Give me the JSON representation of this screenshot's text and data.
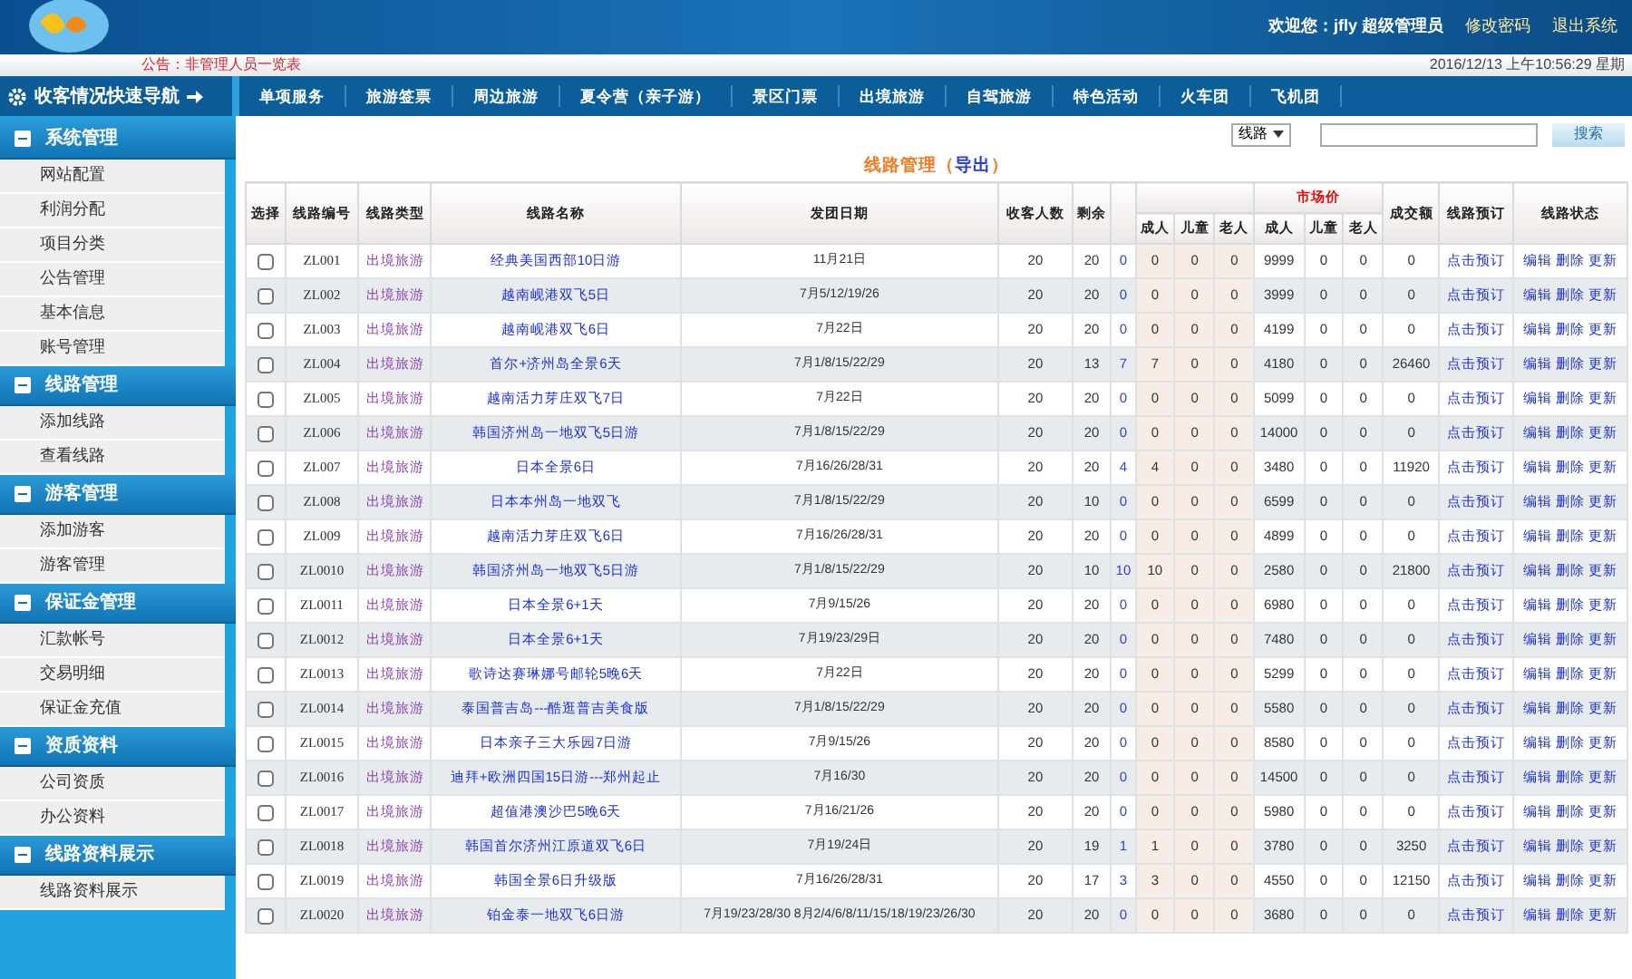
{
  "header": {
    "welcome": "欢迎您：jfly 超级管理员",
    "links": [
      "修改密码",
      "退出系统"
    ],
    "notice": "公告：非管理人员一览表",
    "datetime": "2016/12/13 上午10:56:29 星期"
  },
  "sidebar": {
    "title": "收客情况快速导航",
    "groups": [
      {
        "title": "系统管理",
        "expanded": true,
        "items": [
          "网站配置",
          "利润分配",
          "项目分类",
          "公告管理",
          "基本信息",
          "账号管理"
        ]
      },
      {
        "title": "线路管理",
        "expanded": true,
        "items": [
          "添加线路",
          "查看线路"
        ]
      },
      {
        "title": "游客管理",
        "expanded": true,
        "items": [
          "添加游客",
          "游客管理"
        ]
      },
      {
        "title": "保证金管理",
        "expanded": true,
        "items": [
          "汇款帐号",
          "交易明细",
          "保证金充值"
        ]
      },
      {
        "title": "资质资料",
        "expanded": true,
        "items": [
          "公司资质",
          "办公资料"
        ]
      },
      {
        "title": "线路资料展示",
        "expanded": true,
        "items": [
          "线路资料展示"
        ]
      }
    ]
  },
  "nav": [
    "单项服务",
    "旅游签票",
    "周边旅游",
    "夏令营（亲子游）",
    "景区门票",
    "出境旅游",
    "自驾旅游",
    "特色活动",
    "火车团",
    "飞机团"
  ],
  "search": {
    "filter": "线路",
    "button": "搜索"
  },
  "page_title": {
    "text": "线路管理（",
    "link": "导出",
    "close": "）"
  },
  "table": {
    "columns": [
      "选择",
      "线路编号",
      "线路类型",
      "线路名称",
      "发团日期",
      "收客人数",
      "剩余"
    ],
    "booked_sub": [
      "成人",
      "儿童",
      "老人"
    ],
    "price_group": {
      "label": "市场价",
      "sub": [
        "成人",
        "儿童",
        "老人"
      ]
    },
    "trailing": [
      "成交额",
      "线路预订",
      "线路状态"
    ],
    "rows": [
      {
        "checked": false,
        "id": "ZL001",
        "type": "出境旅游",
        "name": "经典美国西部10日游",
        "date": "11月21日",
        "capacity": "20",
        "remaining": "20",
        "booked": "0",
        "adult": "0",
        "child": "0",
        "senior": "0",
        "price": "9999",
        "price_child": "0",
        "price_senior": "0",
        "total": "0",
        "book": "点击预订",
        "actions": [
          "编辑",
          "删除",
          "更新"
        ]
      },
      {
        "checked": false,
        "id": "ZL002",
        "type": "出境旅游",
        "name": "越南岘港双飞5日",
        "date": "7月5/12/19/26",
        "capacity": "20",
        "remaining": "20",
        "booked": "0",
        "adult": "0",
        "child": "0",
        "senior": "0",
        "price": "3999",
        "price_child": "0",
        "price_senior": "0",
        "total": "0",
        "book": "点击预订",
        "actions": [
          "编辑",
          "删除",
          "更新"
        ]
      },
      {
        "checked": false,
        "id": "ZL003",
        "type": "出境旅游",
        "name": "越南岘港双飞6日",
        "date": "7月22日",
        "capacity": "20",
        "remaining": "20",
        "booked": "0",
        "adult": "0",
        "child": "0",
        "senior": "0",
        "price": "4199",
        "price_child": "0",
        "price_senior": "0",
        "total": "0",
        "book": "点击预订",
        "actions": [
          "编辑",
          "删除",
          "更新"
        ]
      },
      {
        "checked": false,
        "id": "ZL004",
        "type": "出境旅游",
        "name": "首尔+济州岛全景6天",
        "date": "7月1/8/15/22/29",
        "capacity": "20",
        "remaining": "13",
        "booked": "7",
        "adult": "7",
        "child": "0",
        "senior": "0",
        "price": "4180",
        "price_child": "0",
        "price_senior": "0",
        "total": "26460",
        "book": "点击预订",
        "actions": [
          "编辑",
          "删除",
          "更新"
        ]
      },
      {
        "checked": false,
        "id": "ZL005",
        "type": "出境旅游",
        "name": "越南活力芽庄双飞7日",
        "date": "7月22日",
        "capacity": "20",
        "remaining": "20",
        "booked": "0",
        "adult": "0",
        "child": "0",
        "senior": "0",
        "price": "5099",
        "price_child": "0",
        "price_senior": "0",
        "total": "0",
        "book": "点击预订",
        "actions": [
          "编辑",
          "删除",
          "更新"
        ]
      },
      {
        "checked": false,
        "id": "ZL006",
        "type": "出境旅游",
        "name": "韩国济州岛一地双飞5日游",
        "date": "7月1/8/15/22/29",
        "capacity": "20",
        "remaining": "20",
        "booked": "0",
        "adult": "0",
        "child": "0",
        "senior": "0",
        "price": "14000",
        "price_child": "0",
        "price_senior": "0",
        "total": "0",
        "book": "点击预订",
        "actions": [
          "编辑",
          "删除",
          "更新"
        ]
      },
      {
        "checked": false,
        "id": "ZL007",
        "type": "出境旅游",
        "name": "日本全景6日",
        "date": "7月16/26/28/31",
        "capacity": "20",
        "remaining": "20",
        "booked": "4",
        "adult": "4",
        "child": "0",
        "senior": "0",
        "price": "3480",
        "price_child": "0",
        "price_senior": "0",
        "total": "11920",
        "book": "点击预订",
        "actions": [
          "编辑",
          "删除",
          "更新"
        ]
      },
      {
        "checked": false,
        "id": "ZL008",
        "type": "出境旅游",
        "name": "日本本州岛一地双飞",
        "date": "7月1/8/15/22/29",
        "capacity": "20",
        "remaining": "10",
        "booked": "0",
        "adult": "0",
        "child": "0",
        "senior": "0",
        "price": "6599",
        "price_child": "0",
        "price_senior": "0",
        "total": "0",
        "book": "点击预订",
        "actions": [
          "编辑",
          "删除",
          "更新"
        ]
      },
      {
        "checked": false,
        "id": "ZL009",
        "type": "出境旅游",
        "name": "越南活力芽庄双飞6日",
        "date": "7月16/26/28/31",
        "capacity": "20",
        "remaining": "20",
        "booked": "0",
        "adult": "0",
        "child": "0",
        "senior": "0",
        "price": "4899",
        "price_child": "0",
        "price_senior": "0",
        "total": "0",
        "book": "点击预订",
        "actions": [
          "编辑",
          "删除",
          "更新"
        ]
      },
      {
        "checked": false,
        "id": "ZL0010",
        "type": "出境旅游",
        "name": "韩国济州岛一地双飞5日游",
        "date": "7月1/8/15/22/29",
        "capacity": "20",
        "remaining": "10",
        "booked": "10",
        "adult": "10",
        "child": "0",
        "senior": "0",
        "price": "2580",
        "price_child": "0",
        "price_senior": "0",
        "total": "21800",
        "book": "点击预订",
        "actions": [
          "编辑",
          "删除",
          "更新"
        ]
      },
      {
        "checked": false,
        "id": "ZL0011",
        "type": "出境旅游",
        "name": "日本全景6+1天",
        "date": "7月9/15/26",
        "capacity": "20",
        "remaining": "20",
        "booked": "0",
        "adult": "0",
        "child": "0",
        "senior": "0",
        "price": "6980",
        "price_child": "0",
        "price_senior": "0",
        "total": "0",
        "book": "点击预订",
        "actions": [
          "编辑",
          "删除",
          "更新"
        ]
      },
      {
        "checked": false,
        "id": "ZL0012",
        "type": "出境旅游",
        "name": "日本全景6+1天",
        "date": "7月19/23/29日",
        "capacity": "20",
        "remaining": "20",
        "booked": "0",
        "adult": "0",
        "child": "0",
        "senior": "0",
        "price": "7480",
        "price_child": "0",
        "price_senior": "0",
        "total": "0",
        "book": "点击预订",
        "actions": [
          "编辑",
          "删除",
          "更新"
        ]
      },
      {
        "checked": false,
        "id": "ZL0013",
        "type": "出境旅游",
        "name": "歌诗达赛琳娜号邮轮5晚6天",
        "date": "7月22日",
        "capacity": "20",
        "remaining": "20",
        "booked": "0",
        "adult": "0",
        "child": "0",
        "senior": "0",
        "price": "5299",
        "price_child": "0",
        "price_senior": "0",
        "total": "0",
        "book": "点击预订",
        "actions": [
          "编辑",
          "删除",
          "更新"
        ]
      },
      {
        "checked": false,
        "id": "ZL0014",
        "type": "出境旅游",
        "name": "泰国普吉岛---酷逛普吉美食版",
        "date": "7月1/8/15/22/29",
        "capacity": "20",
        "remaining": "20",
        "booked": "0",
        "adult": "0",
        "child": "0",
        "senior": "0",
        "price": "5580",
        "price_child": "0",
        "price_senior": "0",
        "total": "0",
        "book": "点击预订",
        "actions": [
          "编辑",
          "删除",
          "更新"
        ]
      },
      {
        "checked": false,
        "id": "ZL0015",
        "type": "出境旅游",
        "name": "日本亲子三大乐园7日游",
        "date": "7月9/15/26",
        "capacity": "20",
        "remaining": "20",
        "booked": "0",
        "adult": "0",
        "child": "0",
        "senior": "0",
        "price": "8580",
        "price_child": "0",
        "price_senior": "0",
        "total": "0",
        "book": "点击预订",
        "actions": [
          "编辑",
          "删除",
          "更新"
        ]
      },
      {
        "checked": false,
        "id": "ZL0016",
        "type": "出境旅游",
        "name": "迪拜+欧洲四国15日游---郑州起止",
        "date": "7月16/30",
        "capacity": "20",
        "remaining": "20",
        "booked": "0",
        "adult": "0",
        "child": "0",
        "senior": "0",
        "price": "14500",
        "price_child": "0",
        "price_senior": "0",
        "total": "0",
        "book": "点击预订",
        "actions": [
          "编辑",
          "删除",
          "更新"
        ]
      },
      {
        "checked": false,
        "id": "ZL0017",
        "type": "出境旅游",
        "name": "超值港澳沙巴5晚6天",
        "date": "7月16/21/26",
        "capacity": "20",
        "remaining": "20",
        "booked": "0",
        "adult": "0",
        "child": "0",
        "senior": "0",
        "price": "5980",
        "price_child": "0",
        "price_senior": "0",
        "total": "0",
        "book": "点击预订",
        "actions": [
          "编辑",
          "删除",
          "更新"
        ]
      },
      {
        "checked": false,
        "id": "ZL0018",
        "type": "出境旅游",
        "name": "韩国首尔济州江原道双飞6日",
        "date": "7月19/24日",
        "capacity": "20",
        "remaining": "19",
        "booked": "1",
        "adult": "1",
        "child": "0",
        "senior": "0",
        "price": "3780",
        "price_child": "0",
        "price_senior": "0",
        "total": "3250",
        "book": "点击预订",
        "actions": [
          "编辑",
          "删除",
          "更新"
        ]
      },
      {
        "checked": false,
        "id": "ZL0019",
        "type": "出境旅游",
        "name": "韩国全景6日升级版",
        "date": "7月16/26/28/31",
        "capacity": "20",
        "remaining": "17",
        "booked": "3",
        "adult": "3",
        "child": "0",
        "senior": "0",
        "price": "4550",
        "price_child": "0",
        "price_senior": "0",
        "total": "12150",
        "book": "点击预订",
        "actions": [
          "编辑",
          "删除",
          "更新"
        ]
      },
      {
        "checked": false,
        "id": "ZL0020",
        "type": "出境旅游",
        "name": "铂金泰一地双飞6日游",
        "date": "7月19/23/28/30 8月2/4/6/8/11/15/18/19/23/26/30",
        "capacity": "20",
        "remaining": "20",
        "booked": "0",
        "adult": "0",
        "child": "0",
        "senior": "0",
        "price": "3680",
        "price_child": "0",
        "price_senior": "0",
        "total": "0",
        "book": "点击预订",
        "actions": [
          "编辑",
          "删除",
          "更新"
        ]
      }
    ]
  }
}
